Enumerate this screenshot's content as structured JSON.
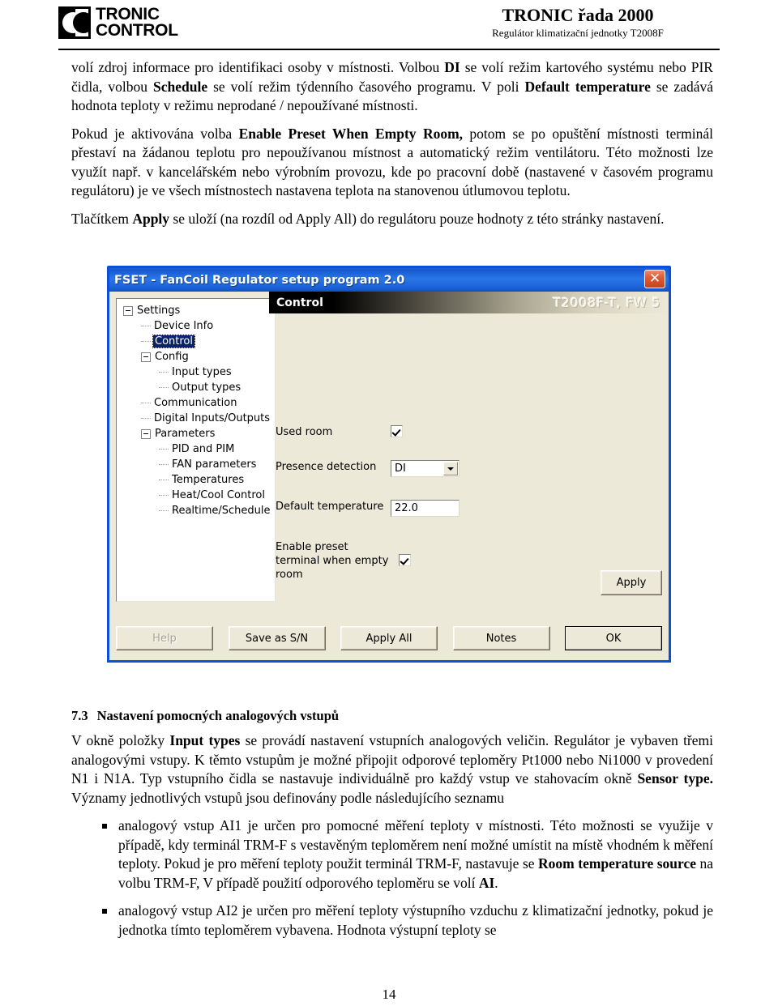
{
  "header": {
    "logo_line1": "TRONIC",
    "logo_line2": "CONTROL",
    "brand_title": "TRONIC řada 2000",
    "brand_subtitle": "Regulátor klimatizační jednotky T2008F"
  },
  "body": {
    "para1_a": "volí zdroj informace pro identifikaci osoby v místnosti. Volbou ",
    "para1_b": "DI",
    "para1_c": " se volí režim kartového systému nebo PIR čidla, volbou ",
    "para1_d": "Schedule",
    "para1_e": " se volí režim týdenního časového programu. V poli ",
    "para1_f": "Default temperature",
    "para1_g": " se zadává hodnota teploty v režimu neprodané / nepoužívané místnosti.",
    "para2_a": "Pokud je aktivována volba ",
    "para2_b": "Enable Preset When Empty Room,",
    "para2_c": " potom se po opuštění místnosti terminál přestaví na žádanou teplotu pro nepoužívanou místnost a automatický režim ventilátoru. Této možnosti lze využít např. v kancelářském nebo výrobním provozu, kde po pracovní době (nastavené v časovém programu regulátoru) je ve všech místnostech nastavena teplota na stanovenou útlumovou teplotu.",
    "para3_a": "Tlačítkem ",
    "para3_b": "Apply",
    "para3_c": " se uloží (na rozdíl od Apply All) do regulátoru pouze hodnoty z této stránky nastavení."
  },
  "dialog": {
    "title": "FSET - FanCoil Regulator setup program 2.0",
    "close_icon": "close-icon",
    "panel_title": "Control",
    "panel_model": "T2008F-T, FW 5",
    "tree": [
      {
        "label": "Settings",
        "indent": 1,
        "expander": true,
        "dash": false,
        "selected": false
      },
      {
        "label": "Device Info",
        "indent": 2,
        "expander": false,
        "dash": true,
        "selected": false
      },
      {
        "label": "Control",
        "indent": 2,
        "expander": false,
        "dash": true,
        "selected": true
      },
      {
        "label": "Config",
        "indent": 2,
        "expander": true,
        "dash": false,
        "selected": false
      },
      {
        "label": "Input types",
        "indent": 3,
        "expander": false,
        "dash": true,
        "selected": false
      },
      {
        "label": "Output types",
        "indent": 3,
        "expander": false,
        "dash": true,
        "selected": false
      },
      {
        "label": "Communication",
        "indent": 2,
        "expander": false,
        "dash": true,
        "selected": false
      },
      {
        "label": "Digital Inputs/Outputs",
        "indent": 2,
        "expander": false,
        "dash": true,
        "selected": false
      },
      {
        "label": "Parameters",
        "indent": 2,
        "expander": true,
        "dash": false,
        "selected": false
      },
      {
        "label": "PID and PIM",
        "indent": 3,
        "expander": false,
        "dash": true,
        "selected": false
      },
      {
        "label": "FAN parameters",
        "indent": 3,
        "expander": false,
        "dash": true,
        "selected": false
      },
      {
        "label": "Temperatures",
        "indent": 3,
        "expander": false,
        "dash": true,
        "selected": false
      },
      {
        "label": "Heat/Cool Control",
        "indent": 3,
        "expander": false,
        "dash": true,
        "selected": false
      },
      {
        "label": "Realtime/Schedule",
        "indent": 3,
        "expander": false,
        "dash": true,
        "selected": false
      }
    ],
    "form": {
      "used_room_label": "Used room",
      "used_room_checked": "checked",
      "presence_label": "Presence detection",
      "presence_value": "DI",
      "default_temp_label": "Default temperature",
      "default_temp_value": "22.0",
      "enable_preset_line1": "Enable preset",
      "enable_preset_line2": "terminal when empty",
      "enable_preset_line3": "room",
      "enable_preset_checked": "checked"
    },
    "apply_label": "Apply",
    "buttons": [
      {
        "label": "Help",
        "disabled": true,
        "default": false
      },
      {
        "label": "Save as S/N",
        "disabled": false,
        "default": false
      },
      {
        "label": "Apply All",
        "disabled": false,
        "default": false
      },
      {
        "label": "Notes",
        "disabled": false,
        "default": false
      },
      {
        "label": "OK",
        "disabled": false,
        "default": true
      }
    ],
    "colors": {
      "titlebar_blue": "#1d62d8",
      "dialog_face": "#ece9d8",
      "selection_blue": "#0a246a",
      "close_red": "#c5431d"
    }
  },
  "section73": {
    "number": "7.3",
    "title": "Nastavení pomocných analogových vstupů",
    "para_a": "V okně položky ",
    "para_b": "Input types",
    "para_c": " se provádí nastavení vstupních analogových veličin. Regulátor je vybaven třemi analogovými vstupy. K těmto vstupům je možné připojit odporové teploměry Pt1000 nebo Ni1000 v provedení N1 i N1A. Typ vstupního čidla se nastavuje individuálně pro každý vstup ve stahovacím okně ",
    "para_d": "Sensor type.",
    "para_e": " Významy jednotlivých vstupů jsou definovány podle následujícího seznamu",
    "bullet1_a": "analogový vstup AI1 je určen pro pomocné měření teploty v místnosti. Této možnosti se využije v případě, kdy terminál TRM-F s vestavěným teploměrem není možné umístit na místě vhodném k měření teploty. Pokud je pro měření teploty použit terminál TRM-F, nastavuje se ",
    "bullet1_b": "Room temperature source",
    "bullet1_c": " na volbu TRM-F,  V případě použití odporového teploměru se volí ",
    "bullet1_d": "AI",
    "bullet1_e": ".",
    "bullet2": "analogový vstup AI2 je určen pro měření teploty výstupního vzduchu z klimatizační jednotky, pokud je jednotka tímto teploměrem vybavena. Hodnota výstupní teploty se"
  },
  "page_number": "14"
}
